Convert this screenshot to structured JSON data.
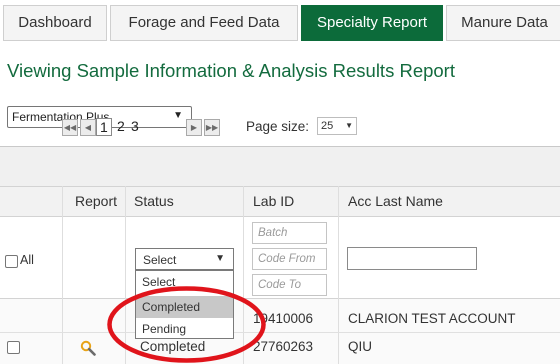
{
  "tabs": [
    {
      "label": "Dashboard",
      "active": false
    },
    {
      "label": "Forage and Feed Data",
      "active": false
    },
    {
      "label": "Specialty Report",
      "active": true
    },
    {
      "label": "Manure Data",
      "active": false
    }
  ],
  "report_title": "Viewing Sample Information & Analysis Results Report",
  "report_select": {
    "value": "Fermentation Plus"
  },
  "pager": {
    "pages": [
      "1",
      "2",
      "3"
    ],
    "current_page": "1",
    "page_size_label": "Page size:",
    "page_size": "25"
  },
  "columns": {
    "report": "Report",
    "status": "Status",
    "lab_id": "Lab ID",
    "acc_last_name": "Acc Last Name"
  },
  "filters": {
    "all_label": "All",
    "status_select": "Select",
    "status_options": [
      "Select",
      "Completed",
      "Pending"
    ],
    "highlighted_option": "Completed",
    "batch_placeholder": "Batch",
    "code_from_placeholder": "Code From",
    "code_to_placeholder": "Code To"
  },
  "rows": [
    {
      "lab_id": "19410006",
      "acc_last_name": "CLARION TEST ACCOUNT",
      "status": ""
    },
    {
      "lab_id": "27760263",
      "acc_last_name": "QIU",
      "status": "Completed"
    }
  ],
  "colors": {
    "accent": "#0c6b3a",
    "title": "#136b3e",
    "annotation": "#e0141b",
    "magnify": "#e8a317"
  }
}
